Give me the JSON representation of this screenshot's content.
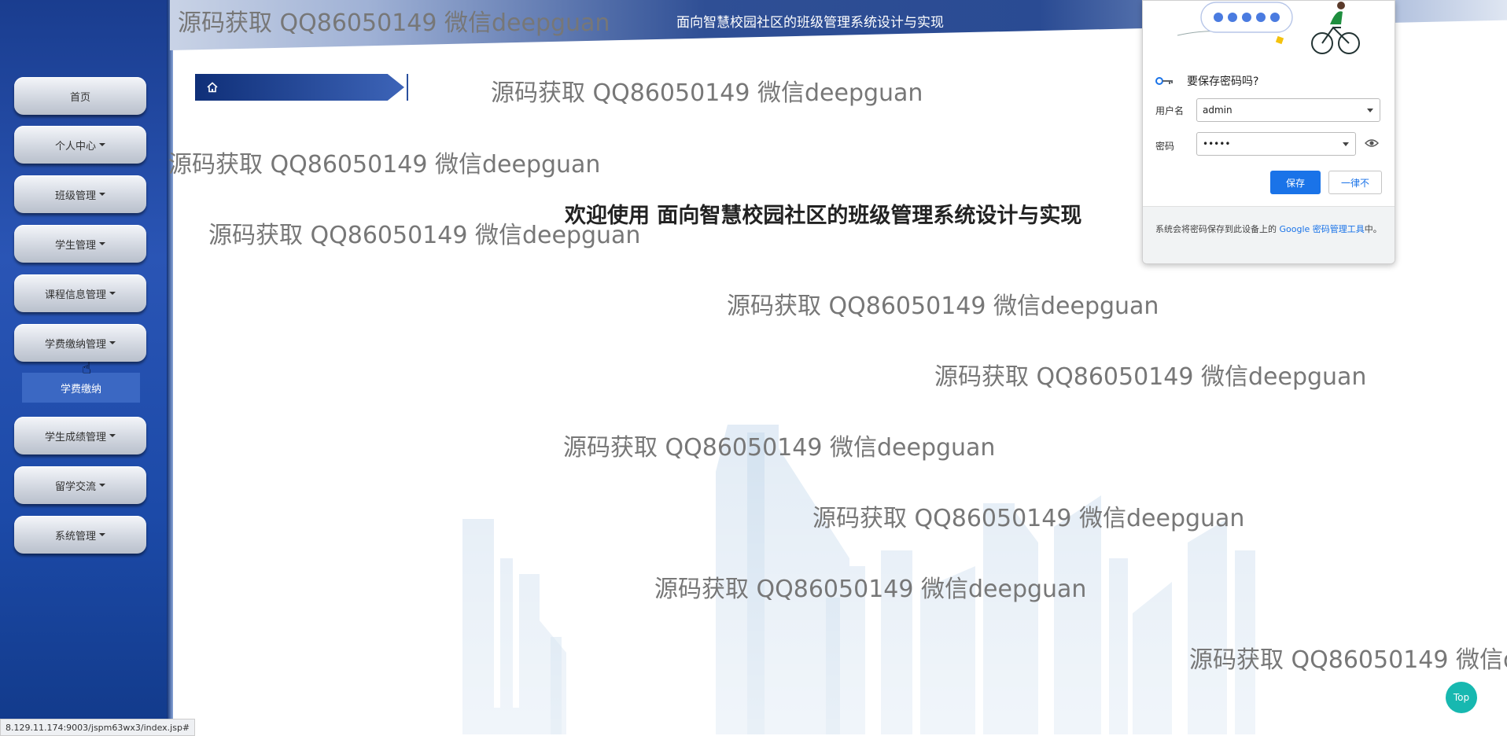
{
  "header": {
    "title": "面向智慧校园社区的班级管理系统设计与实现"
  },
  "sidebar": {
    "items": [
      {
        "label": "首页",
        "caret": false
      },
      {
        "label": "个人中心",
        "caret": true
      },
      {
        "label": "班级管理",
        "caret": true
      },
      {
        "label": "学生管理",
        "caret": true
      },
      {
        "label": "课程信息管理",
        "caret": true
      },
      {
        "label": "学费缴纳管理",
        "caret": true
      },
      {
        "label": "学生成绩管理",
        "caret": true
      },
      {
        "label": "留学交流",
        "caret": true
      },
      {
        "label": "系统管理",
        "caret": true
      }
    ],
    "subitem": "学费缴纳"
  },
  "welcome": "欢迎使用 面向智慧校园社区的班级管理系统设计与实现",
  "watermark": "源码获取 QQ86050149 微信deepguan",
  "password_popup": {
    "question": "要保存密码吗?",
    "username_label": "用户名",
    "username_value": "admin",
    "password_label": "密码",
    "password_value": "•••••",
    "save_label": "保存",
    "never_label": "一律不",
    "note_prefix": "系统会将密码保存到此设备上的 ",
    "note_link": "Google 密码管理工具",
    "note_suffix": "中。"
  },
  "top_button": "Top",
  "status_url": "8.129.11.174:9003/jspm63wx3/index.jsp#"
}
